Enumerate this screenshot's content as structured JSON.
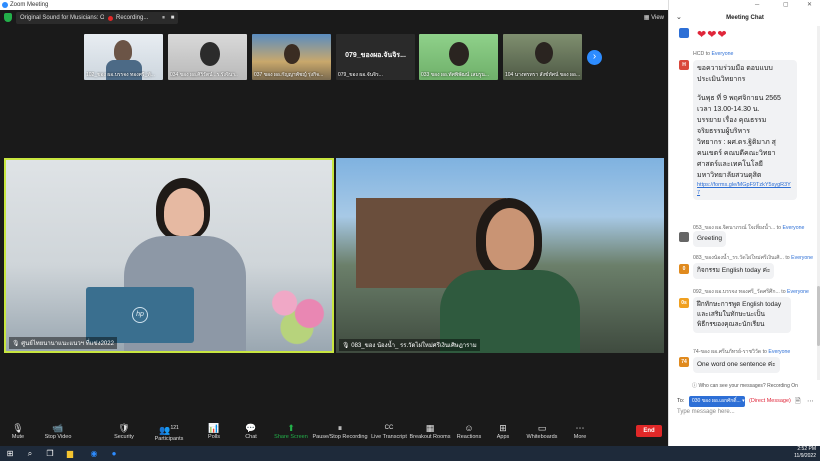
{
  "window": {
    "title": "Zoom Meeting"
  },
  "topbar": {
    "original_sound": "Original Sound for Musicians: Off",
    "recording": "Recording...",
    "view": "View"
  },
  "thumbnails": [
    {
      "name": "102_ของ ผอ.บรรจง ทองศรี_ทุ้..."
    },
    {
      "name": "034 ของ ผอ.ศิริรัตน์ ..ร.รังจินา.."
    },
    {
      "name": "037 ของ ผอ.กัญญาพัชญ์ รุ่งกิจ..."
    },
    {
      "name": "079_ของ ผอ.จันจิร...",
      "large_label": "079_ของผอ.จันจิร..."
    },
    {
      "name": "033 ของ ผอ.ทัศพิพัฒน์ เสมรูน..."
    },
    {
      "name": "104 นางพรทรา สังข์ทัศน์ ของ ผอ..."
    }
  ],
  "videos": {
    "main_left": {
      "name": "ศูนย์ไทยนานาแนะแนวฯ ที่แข่ง2022"
    },
    "main_right": {
      "name": "083_ของ น้องน้ำ_ รร.วัดไผ่ใหม่ศรีเงินเศิษฎาราม"
    },
    "laptop_logo": "hp"
  },
  "toolbar": {
    "items": [
      {
        "label": "Mute",
        "icon": "microphone-icon",
        "glyph": "🎙"
      },
      {
        "label": "Stop Video",
        "icon": "video-camera-icon",
        "glyph": "📹"
      },
      {
        "label": "Security",
        "icon": "shield-icon",
        "glyph": "🛡"
      },
      {
        "label": "Participants",
        "icon": "participants-icon",
        "glyph": "👥",
        "count": "121"
      },
      {
        "label": "Polls",
        "icon": "polls-icon",
        "glyph": "📊"
      },
      {
        "label": "Chat",
        "icon": "chat-icon",
        "glyph": "💬"
      },
      {
        "label": "Share Screen",
        "icon": "share-screen-icon",
        "glyph": "⬆"
      },
      {
        "label": "Pause/Stop Recording",
        "icon": "recording-controls-icon",
        "glyph": "⏸"
      },
      {
        "label": "Live Transcript",
        "icon": "closed-caption-icon",
        "glyph": "CC"
      },
      {
        "label": "Breakout Rooms",
        "icon": "breakout-rooms-icon",
        "glyph": "▦"
      },
      {
        "label": "Reactions",
        "icon": "reactions-icon",
        "glyph": "☺"
      },
      {
        "label": "Apps",
        "icon": "apps-icon",
        "glyph": "⊞"
      },
      {
        "label": "Whiteboards",
        "icon": "whiteboard-icon",
        "glyph": "▭"
      },
      {
        "label": "More",
        "icon": "more-icon",
        "glyph": "⋯"
      }
    ],
    "end_label": "End",
    "share_color": "#23b04a",
    "end_color": "#e02828"
  },
  "chat": {
    "title": "Meeting Chat",
    "messages": [
      {
        "avatar": "H",
        "avatar_color": "#d9473b",
        "from": "HCD",
        "to": "Everyone",
        "text_lines": [
          "ขอความร่วมมือ ตอบแบบ",
          "ประเมินวิทยากร",
          "",
          "วันพุธ ที่ 9 พฤศจิกายน 2565",
          "เวลา 13.00-14.30 น.",
          "บรรยาย เรื่อง คุณธรรม",
          "จริยธรรมผู้บริหาร",
          "วิทยากร : ผศ.ดร.ฐิติมาภ สุ",
          "คนเขตร์ คณบดีคณะวิทยา",
          "ศาสตร์และเทคโนโลยี",
          "มหาวิทยาลัยสวนดุสิต"
        ],
        "link": "https://forms.gle/MGpF9TzkY5sygR3Y7"
      },
      {
        "avatar": "",
        "avatar_color": "#666666",
        "from": "053_ของ ผอ.จิตนาภรณ์ ใจเที่ยงน้ำ...",
        "to": "Everyone",
        "text": "Greeting"
      },
      {
        "avatar": "0",
        "avatar_color": "#e08a1e",
        "from": "083_ของน้องน้ำ_รร.วัดไผ่ใหม่ศรีเงินเศิ...",
        "to": "Everyone",
        "text": "กิจกรรม English today ค่ะ"
      },
      {
        "avatar": "0s",
        "avatar_color": "#f0a020",
        "from": "092_ของ ผอ.บรรจง ทองศรี_วัดศรีศึก...",
        "to": "Everyone",
        "text_lines": [
          "ฝึกทักษะการพูด English today",
          "และเสริมในทักษะนะเป็น",
          "พิธีกรของคุณละนักเรียน"
        ]
      },
      {
        "avatar": "74",
        "avatar_color": "#e08a1e",
        "from": "74-ของ ผอ.ศรีนภัทรย์-ราชวิวัด",
        "to": "Everyone",
        "text": "One word one sentence ค่ะ"
      }
    ],
    "who_can_see": "Who can see your messages? Recording On",
    "to_label": "To:",
    "to_value": "030 ของ ผอ.เอกศักดิ์...",
    "direct_message": "(Direct Message)",
    "input_placeholder": "Type message here..."
  },
  "taskbar": {
    "time": "2:52 PM",
    "date": "11/9/2022"
  }
}
